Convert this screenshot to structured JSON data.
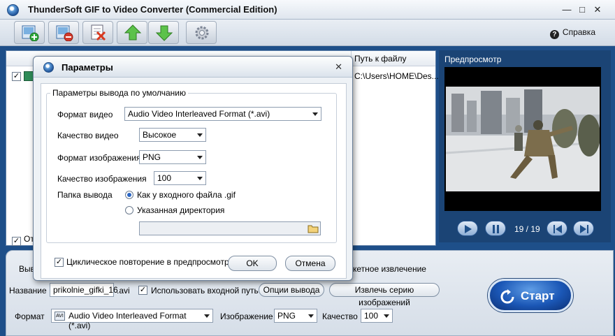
{
  "window": {
    "title": "ThunderSoft GIF to Video Converter (Commercial Edition)"
  },
  "toolbar": {
    "help_label": "Справка",
    "buttons": [
      "add-file-icon",
      "remove-file-icon",
      "clear-list-icon",
      "move-up-icon",
      "move-down-icon",
      "settings-icon"
    ]
  },
  "filelist": {
    "column_path": "Путь к файлу",
    "row_path": "C:\\Users\\HOME\\Des...",
    "bottom_label": "От"
  },
  "preview": {
    "label": "Предпросмотр",
    "counter": "19 / 19"
  },
  "bottom": {
    "partial_label": "Выв",
    "batch_label": "кетное извлечение",
    "name_label": "Название",
    "name_value": "prikolnie_gifki_16",
    "extension": ".avi",
    "use_input_path_label": "Использовать входной путь",
    "output_options_button": "Опции вывода",
    "extract_series_button": "Извлечь серию изображений",
    "format_label": "Формат",
    "format_value": "Audio Video Interleaved Format (*.avi)",
    "image_label": "Изображение",
    "image_value": "PNG",
    "quality_label": "Качество",
    "quality_value": "100",
    "start_label": "Старт"
  },
  "dialog": {
    "title": "Параметры",
    "group_legend": "Параметры вывода по умолчанию",
    "video_format_label": "Формат видео",
    "video_format_value": "Audio Video Interleaved Format (*.avi)",
    "video_quality_label": "Качество видео",
    "video_quality_value": "Высокое",
    "image_format_label": "Формат изображения",
    "image_format_value": "PNG",
    "image_quality_label": "Качество изображения",
    "image_quality_value": "100",
    "output_folder_label": "Папка вывода",
    "radio_same_as_input": "Как у входного файла .gif",
    "radio_custom_dir": "Указанная директория",
    "custom_dir_value": "",
    "loop_preview_label": "Циклическое повторение в предпросмотре",
    "ok_button": "OK",
    "cancel_button": "Отмена"
  },
  "colors": {
    "workarea": "#1e4f89",
    "accent": "#1b57b6"
  }
}
